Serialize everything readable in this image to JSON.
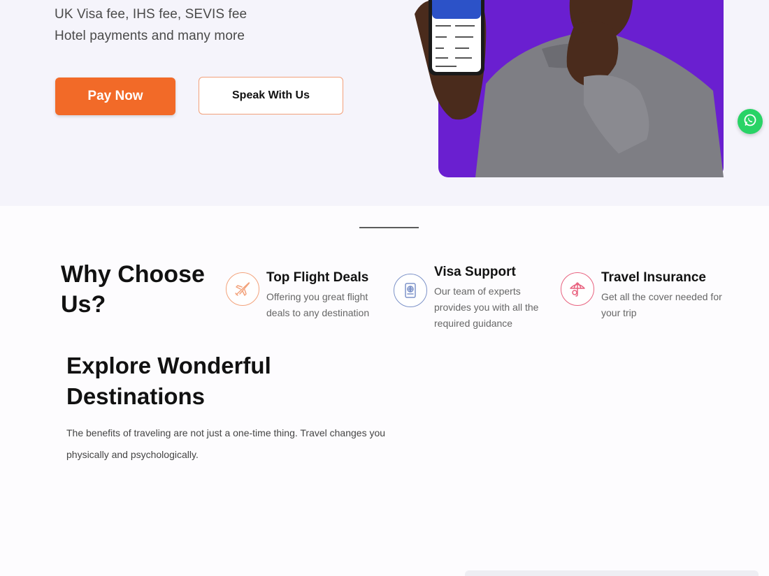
{
  "hero": {
    "line1": "UK Visa fee, IHS fee, SEVIS fee",
    "line2": "Hotel payments and many more",
    "pay_button": "Pay Now",
    "speak_button": "Speak With Us"
  },
  "why": {
    "title": "Why Choose Us?",
    "features": [
      {
        "title": "Top Flight Deals",
        "desc": "Offering you great flight deals to any destination",
        "icon": "plane-icon",
        "color": "#f3a37c"
      },
      {
        "title": "Visa Support",
        "desc": "Our team of experts provides you with all the required guidance",
        "icon": "passport-icon",
        "color": "#7d93c9"
      },
      {
        "title": "Travel Insurance",
        "desc": "Get all the cover needed for your trip",
        "icon": "umbrella-icon",
        "color": "#e8627f"
      }
    ]
  },
  "explore": {
    "title": "Explore Wonderful Destinations",
    "desc": "The benefits of traveling are not just a one-time thing. Travel changes you physically and psychologically."
  },
  "colors": {
    "accent": "#f26a28",
    "hero_bg": "#f5f4fb",
    "image_bg": "#6a1fd0",
    "whatsapp": "#29d366"
  }
}
